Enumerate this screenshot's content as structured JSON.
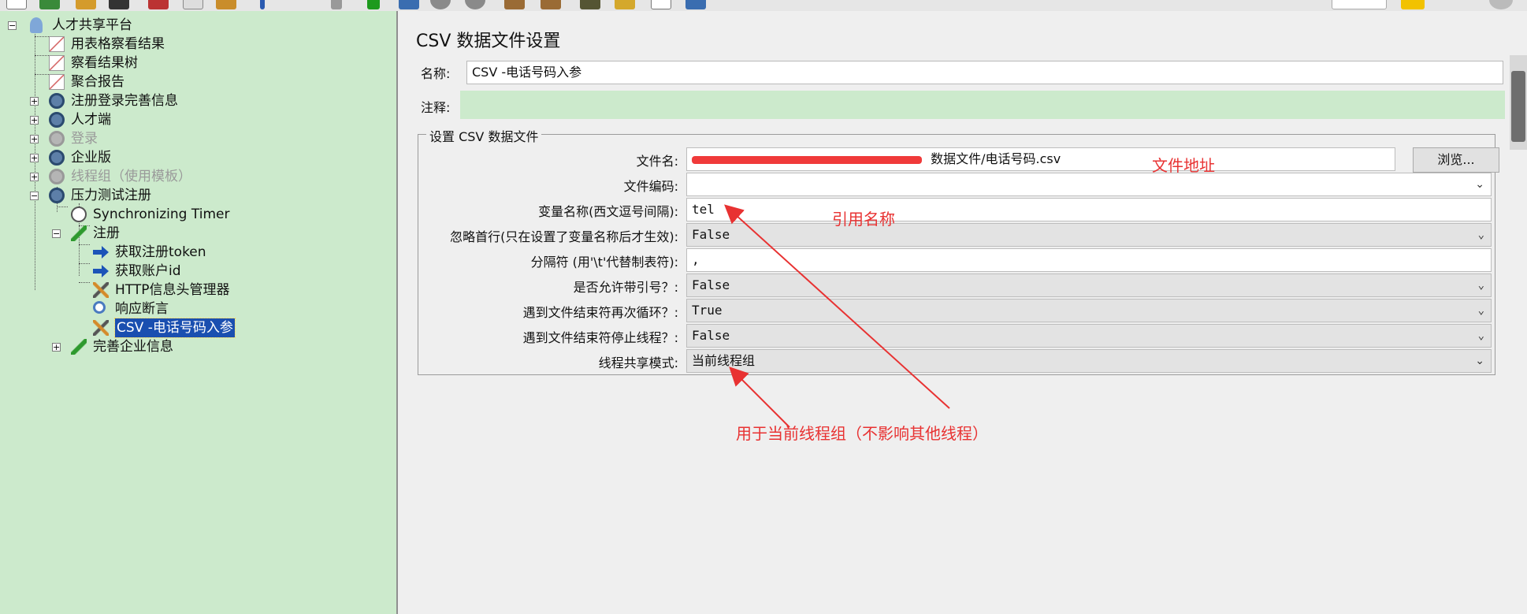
{
  "tree": {
    "items": [
      {
        "label": "人才共享平台"
      },
      {
        "label": "用表格察看结果"
      },
      {
        "label": "察看结果树"
      },
      {
        "label": "聚合报告"
      },
      {
        "label": "注册登录完善信息"
      },
      {
        "label": "人才端"
      },
      {
        "label": "登录"
      },
      {
        "label": "企业版"
      },
      {
        "label": "线程组（使用模板）"
      },
      {
        "label": "压力测试注册"
      },
      {
        "label": "Synchronizing Timer"
      },
      {
        "label": "注册"
      },
      {
        "label": "获取注册token"
      },
      {
        "label": "获取账户id"
      },
      {
        "label": "HTTP信息头管理器"
      },
      {
        "label": "响应断言"
      },
      {
        "label": "CSV -电话号码入参"
      },
      {
        "label": "完善企业信息"
      }
    ]
  },
  "panel": {
    "title": "CSV 数据文件设置",
    "name_label": "名称:",
    "name_value": "CSV -电话号码入参",
    "comment_label": "注释:",
    "group_title": "设置 CSV 数据文件",
    "browse_label": "浏览...",
    "fields": [
      {
        "label": "文件名:",
        "value": "数据文件/电话号码.csv"
      },
      {
        "label": "文件编码:",
        "value": ""
      },
      {
        "label": "变量名称(西文逗号间隔):",
        "value": "tel"
      },
      {
        "label": "忽略首行(只在设置了变量名称后才生效):",
        "value": "False"
      },
      {
        "label": "分隔符 (用'\\t'代替制表符):",
        "value": ","
      },
      {
        "label": "是否允许带引号？:",
        "value": "False"
      },
      {
        "label": "遇到文件结束符再次循环？:",
        "value": "True"
      },
      {
        "label": "遇到文件结束符停止线程？:",
        "value": "False"
      },
      {
        "label": "线程共享模式:",
        "value": "当前线程组"
      }
    ]
  },
  "annotations": {
    "file_address": "文件地址",
    "reference_name": "引用名称",
    "current_group_note": "用于当前线程组（不影响其他线程）",
    "color": "#e83232"
  },
  "colors": {
    "tree_bg": "#cceacc",
    "selection": "#1a4fb0",
    "annotation": "#e83232"
  }
}
